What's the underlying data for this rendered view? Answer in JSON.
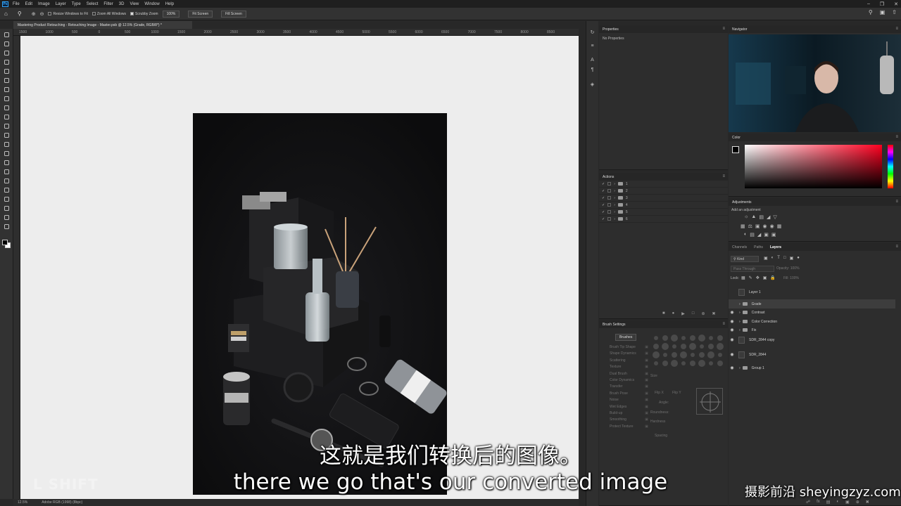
{
  "menubar": {
    "items": [
      "File",
      "Edit",
      "Image",
      "Layer",
      "Type",
      "Select",
      "Filter",
      "3D",
      "View",
      "Window",
      "Help"
    ]
  },
  "options": {
    "resize_windows": "Resize Windows to Fit",
    "zoom_all": "Zoom All Windows",
    "scrubby_zoom": "Scrubby Zoom",
    "zoom_value": "100%",
    "fit_screen": "Fit Screen",
    "fill_screen": "Fill Screen"
  },
  "document": {
    "tab_title": "Mastering Product Retouching - Retouching Image - Master.psb @ 12.5% (Grade, RGB/8*) *",
    "ruler_labels": [
      "1500",
      "1000",
      "500",
      "0",
      "500",
      "1000",
      "1500",
      "2000",
      "2500",
      "3000",
      "3500",
      "4000",
      "4500",
      "5000",
      "5500",
      "6000",
      "6500",
      "7000",
      "7500",
      "8000",
      "8500"
    ]
  },
  "status": {
    "zoom": "12.5%",
    "profile": "Adobe RGB (1998) (8bpc)"
  },
  "properties": {
    "title": "Properties",
    "body": "No Properties"
  },
  "actions": {
    "title": "Actions",
    "rows": [
      "1",
      "2",
      "3",
      "4",
      "5",
      "6"
    ]
  },
  "brush_settings": {
    "title": "Brush Settings",
    "brushes_button": "Brushes",
    "options": [
      "Brush Tip Shape",
      "Shape Dynamics",
      "Scattering",
      "Texture",
      "Dual Brush",
      "Color Dynamics",
      "Transfer",
      "Brush Pose",
      "Noise",
      "Wet Edges",
      "Build-up",
      "Smoothing",
      "Protect Texture"
    ],
    "size_label": "Size",
    "flip_x": "Flip X",
    "flip_y": "Flip Y",
    "angle": "Angle:",
    "roundness": "Roundness:",
    "hardness": "Hardness",
    "spacing": "Spacing"
  },
  "navigator": {
    "title": "Navigator"
  },
  "color": {
    "title": "Color"
  },
  "adjustments": {
    "title": "Adjustments",
    "subtitle": "Add an adjustment"
  },
  "layers": {
    "tabs": [
      "Channels",
      "Paths",
      "Layers"
    ],
    "kind": "Kind",
    "blend": "Pass Through",
    "opacity": "Opacity: 100%",
    "lock": "Lock:",
    "fill": "Fill: 100%",
    "rows": [
      "Layer 1",
      "Grade",
      "Contrast",
      "Color Correction",
      "Fix",
      "SDR_2844 copy",
      "SDR_2844",
      "Group 1"
    ]
  },
  "subtitles": {
    "cn": "这就是我们转换后的图像。",
    "en": "there we go that's our converted image"
  },
  "watermark": "摄影前沿 sheyingzyz.com",
  "logo_text": "L SHIFT",
  "colors": {
    "accent": "#31a8ff",
    "canvas_bg": "#ededed",
    "photo_bg": "#121214"
  }
}
